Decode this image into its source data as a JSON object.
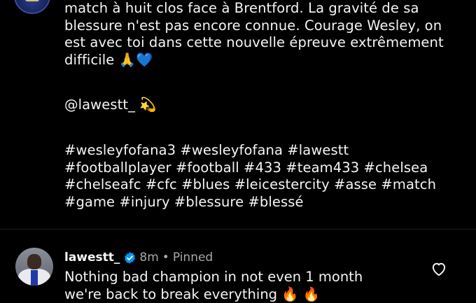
{
  "post": {
    "caption_lines": [
      "match à huit clos face à Brentford. La gravité de sa",
      "blessure n'est pas encore connue. Courage Wesley, on",
      "est avec toi dans cette nouvelle épreuve extrêmement",
      "difficile"
    ],
    "caption_emojis": [
      "🙏",
      "💙"
    ],
    "mention": "@lawestt_",
    "mention_emoji": "💫",
    "hashtag_lines": [
      "#wesleyfofana3 #wesleyfofana #lawestt",
      "#footballplayer #football #433 #team433 #chelsea",
      "#chelseafc #cfc #blues #leicestercity #asse #match",
      "#game #injury #blessure #blessé"
    ]
  },
  "comment": {
    "username": "lawestt_",
    "verified_icon": "verified-badge-icon",
    "time": "8m",
    "separator": "•",
    "pinned_label": "Pinned",
    "text_lines": [
      "Nothing bad champion in not even 1 month",
      "we're back to break everything"
    ],
    "text_emojis": [
      "🔥",
      "🔥"
    ],
    "like_icon": "heart-outline-icon"
  },
  "colors": {
    "background": "#000000",
    "primary_text": "#f5f5f5",
    "secondary_text": "#a8a8a8",
    "verified": "#0095f6",
    "divider": "#1c1c1c"
  }
}
